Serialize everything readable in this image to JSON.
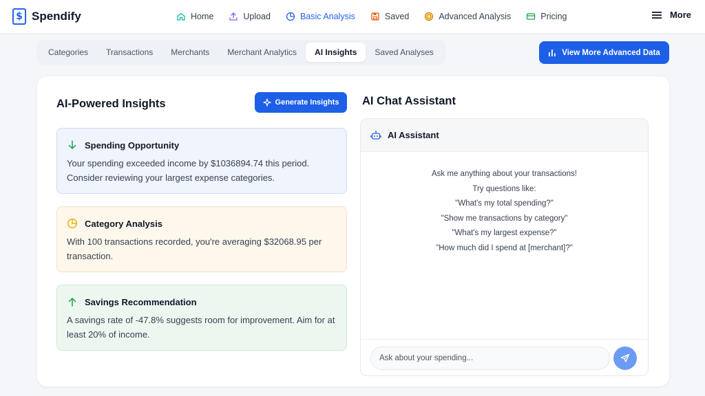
{
  "brand": {
    "logo_glyph": "$",
    "name": "Spendify"
  },
  "nav": {
    "items": [
      {
        "label": "Home",
        "icon": "home-icon"
      },
      {
        "label": "Upload",
        "icon": "upload-icon"
      },
      {
        "label": "Basic Analysis",
        "icon": "pie-chart-icon",
        "active": true
      },
      {
        "label": "Saved",
        "icon": "save-icon"
      },
      {
        "label": "Advanced Analysis",
        "icon": "coin-icon"
      },
      {
        "label": "Pricing",
        "icon": "card-icon"
      }
    ],
    "more_label": "More"
  },
  "tabs": {
    "items": [
      "Categories",
      "Transactions",
      "Merchants",
      "Merchant Analytics",
      "AI Insights",
      "Saved Analyses"
    ],
    "active": "AI Insights"
  },
  "advanced_button": {
    "label": "View More Advanced Data",
    "icon": "bar-chart-icon"
  },
  "insights": {
    "title": "AI-Powered Insights",
    "generate_label": "Generate Insights",
    "cards": [
      {
        "title": "Spending Opportunity",
        "text": "Your spending exceeded income by $1036894.74 this period. Consider reviewing your largest expense categories.",
        "icon": "arrow-down-icon",
        "color": "#16a34a"
      },
      {
        "title": "Category Analysis",
        "text": "With 100 transactions recorded, you're averaging $32068.95 per transaction.",
        "icon": "pie-chart-icon",
        "color": "#eab308"
      },
      {
        "title": "Savings Recommendation",
        "text": "A savings rate of -47.8% suggests room for improvement. Aim for at least 20% of income.",
        "icon": "arrow-up-icon",
        "color": "#16a34a"
      }
    ]
  },
  "chat": {
    "title": "AI Chat Assistant",
    "header": "AI Assistant",
    "intro": "Ask me anything about your transactions!",
    "try_label": "Try questions like:",
    "questions": [
      "\"What's my total spending?\"",
      "\"Show me transactions by category\"",
      "\"What's my largest expense?\"",
      "\"How much did I spend at [merchant]?\""
    ],
    "input_placeholder": "Ask about your spending..."
  },
  "colors": {
    "accent": "#1d5fe6",
    "send_button": "#6b9bf3"
  }
}
